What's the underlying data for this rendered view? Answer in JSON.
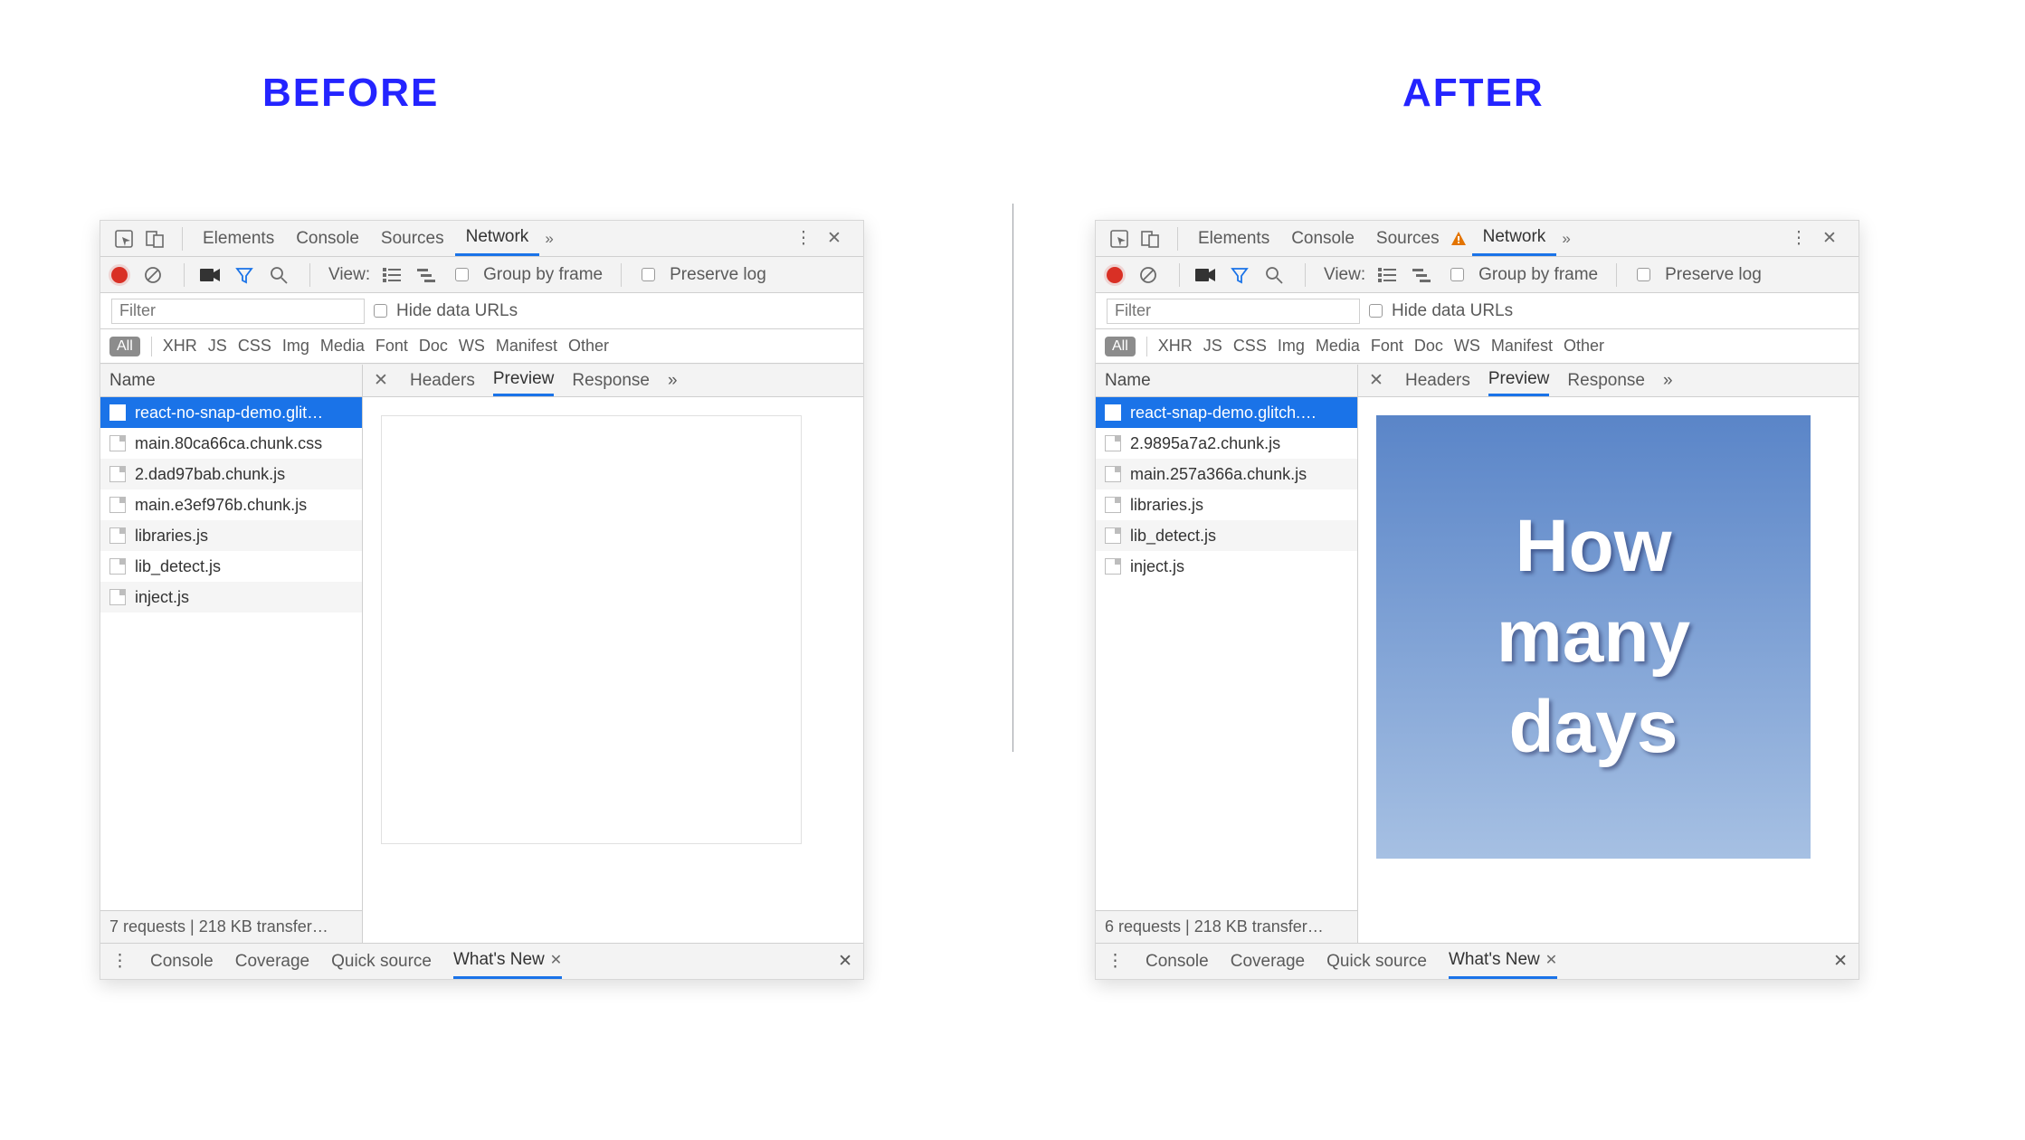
{
  "headings": {
    "before": "BEFORE",
    "after": "AFTER"
  },
  "tabs": {
    "elements": "Elements",
    "console": "Console",
    "sources": "Sources",
    "network": "Network"
  },
  "toolbar": {
    "view": "View:",
    "group": "Group by frame",
    "preserve": "Preserve log"
  },
  "filter": {
    "placeholder": "Filter",
    "hide": "Hide data URLs"
  },
  "types": {
    "all": "All",
    "xhr": "XHR",
    "js": "JS",
    "css": "CSS",
    "img": "Img",
    "media": "Media",
    "font": "Font",
    "doc": "Doc",
    "ws": "WS",
    "manifest": "Manifest",
    "other": "Other"
  },
  "name_header": "Name",
  "detail_tabs": {
    "headers": "Headers",
    "preview": "Preview",
    "response": "Response"
  },
  "drawer": {
    "console": "Console",
    "coverage": "Coverage",
    "quick": "Quick source",
    "whatsnew": "What's New"
  },
  "before": {
    "requests": [
      "react-no-snap-demo.glit…",
      "main.80ca66ca.chunk.css",
      "2.dad97bab.chunk.js",
      "main.e3ef976b.chunk.js",
      "libraries.js",
      "lib_detect.js",
      "inject.js"
    ],
    "summary": "7 requests | 218 KB transfer…"
  },
  "after": {
    "requests": [
      "react-snap-demo.glitch.…",
      "2.9895a7a2.chunk.js",
      "main.257a366a.chunk.js",
      "libraries.js",
      "lib_detect.js",
      "inject.js"
    ],
    "summary": "6 requests | 218 KB transfer…",
    "preview_text": [
      "How",
      "many",
      "days"
    ]
  }
}
